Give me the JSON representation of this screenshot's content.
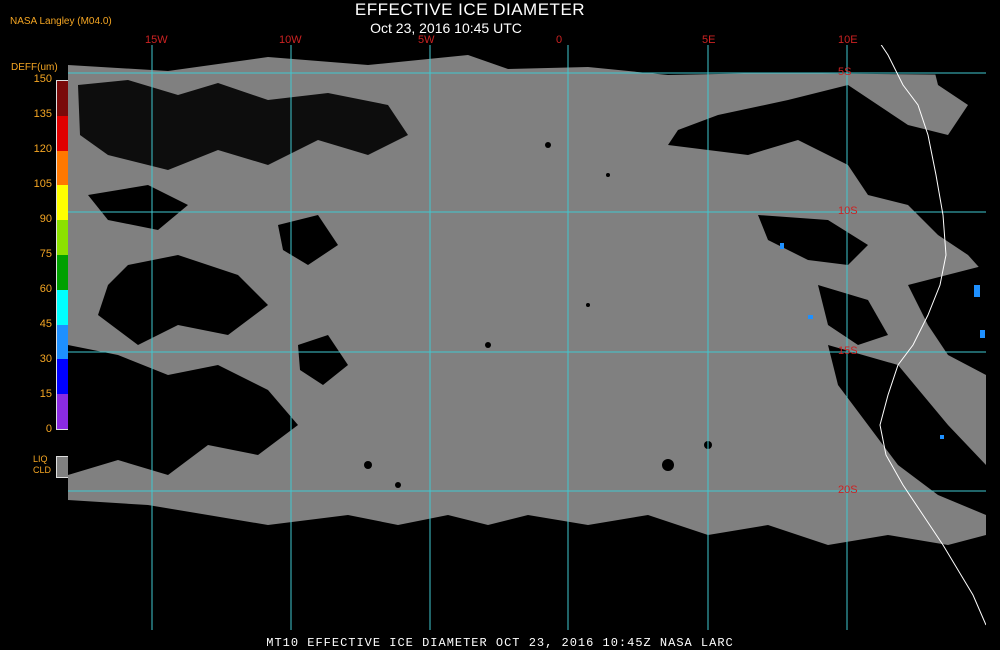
{
  "header": {
    "title": "EFFECTIVE ICE DIAMETER",
    "subtitle": "Oct 23, 2016 10:45 UTC",
    "source": "NASA Langley (M04.0)"
  },
  "legend": {
    "unit_label": "DEFF(um)",
    "ticks": [
      "150",
      "135",
      "120",
      "105",
      "90",
      "75",
      "60",
      "45",
      "30",
      "15",
      "0"
    ],
    "colors": [
      "#7a0a0a",
      "#e00000",
      "#ff7800",
      "#ffff00",
      "#8ce000",
      "#00a000",
      "#00ffff",
      "#1e90ff",
      "#0000ff",
      "#8a2be2"
    ],
    "liq_label_1": "LIQ",
    "liq_label_2": "CLD",
    "liq_color": "#808080"
  },
  "map": {
    "grid_color": "#40c8d0",
    "cloud_color": "#808080",
    "coast_color": "#ffffff",
    "lon_labels": [
      "15W",
      "10W",
      "5W",
      "0",
      "5E",
      "10E"
    ],
    "lat_labels": [
      "5S",
      "10S",
      "15S",
      "20S"
    ]
  },
  "footer": {
    "text": "MT10  EFFECTIVE ICE DIAMETER   OCT 23, 2016 10:45Z   NASA LARC"
  }
}
